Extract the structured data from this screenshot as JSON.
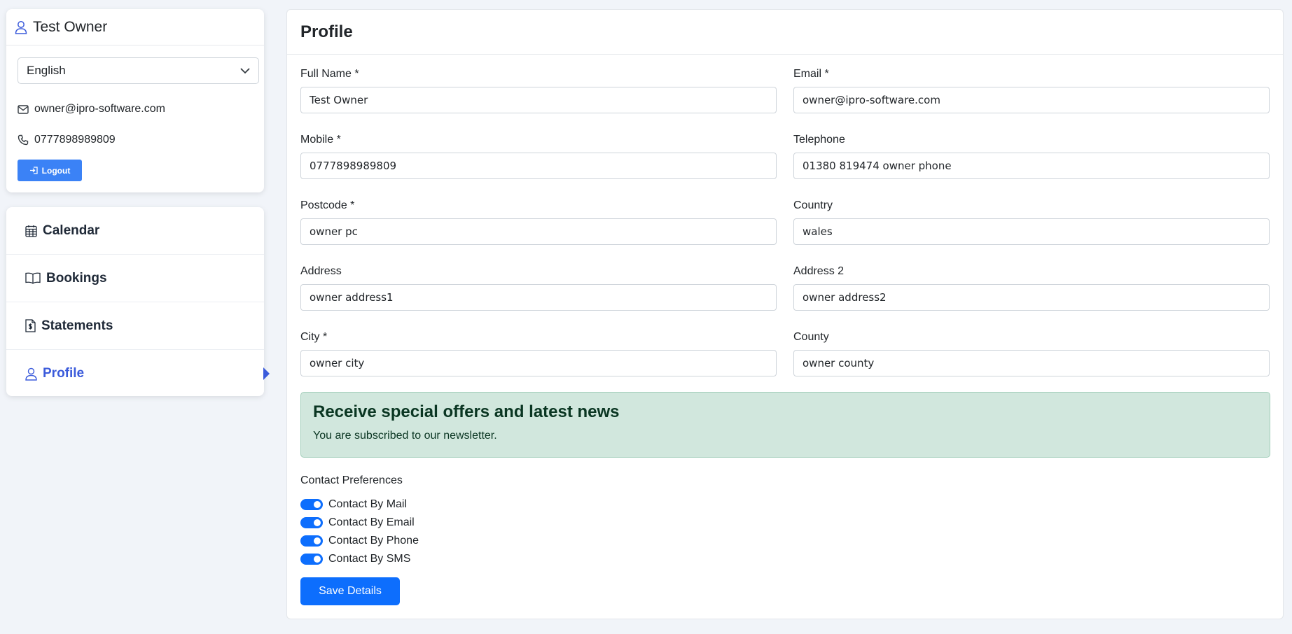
{
  "user": {
    "name": "Test Owner",
    "language": "English",
    "email": "owner@ipro-software.com",
    "phone": "0777898989809",
    "logout_label": "Logout"
  },
  "nav": {
    "items": [
      {
        "label": "Calendar",
        "icon": "calendar-icon"
      },
      {
        "label": "Bookings",
        "icon": "book-icon"
      },
      {
        "label": "Statements",
        "icon": "statement-icon"
      },
      {
        "label": "Profile",
        "icon": "user-icon",
        "active": true
      }
    ]
  },
  "profile": {
    "title": "Profile",
    "fields": {
      "full_name": {
        "label": "Full Name *",
        "value": "Test Owner"
      },
      "email": {
        "label": "Email *",
        "value": "owner@ipro-software.com"
      },
      "mobile": {
        "label": "Mobile *",
        "value": "0777898989809"
      },
      "telephone": {
        "label": "Telephone",
        "value": "01380 819474 owner phone"
      },
      "postcode": {
        "label": "Postcode *",
        "value": "owner pc"
      },
      "country": {
        "label": "Country",
        "value": "wales"
      },
      "address": {
        "label": "Address",
        "value": "owner address1"
      },
      "address2": {
        "label": "Address 2",
        "value": "owner address2"
      },
      "city": {
        "label": "City *",
        "value": "owner city"
      },
      "county": {
        "label": "County",
        "value": "owner county"
      }
    },
    "newsletter": {
      "heading": "Receive special offers and latest news",
      "text": "You are subscribed to our newsletter."
    },
    "preferences": {
      "label": "Contact Preferences",
      "items": [
        {
          "label": "Contact By Mail",
          "checked": true
        },
        {
          "label": "Contact By Email",
          "checked": true
        },
        {
          "label": "Contact By Phone",
          "checked": true
        },
        {
          "label": "Contact By SMS",
          "checked": true
        }
      ]
    },
    "save_label": "Save Details"
  },
  "colors": {
    "accent": "#0d6efd",
    "nav_active": "#3b5bdb",
    "logout": "#3b82f6",
    "success_bg": "#d1e7dd"
  }
}
